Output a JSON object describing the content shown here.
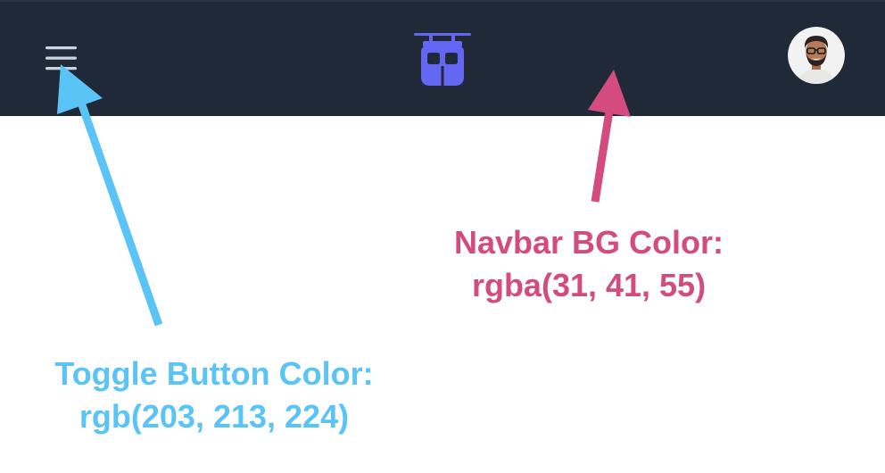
{
  "navbar": {
    "background_color": "#1f2937",
    "toggle_icon": "hamburger-menu-icon",
    "toggle_color": "#cbd5e0",
    "logo_icon": "cable-car-icon",
    "logo_color": "#6366f1",
    "avatar_icon": "user-avatar-icon"
  },
  "annotations": {
    "navbar_bg": {
      "title": "Navbar BG Color:",
      "value": "rgba(31, 41, 55)",
      "color": "#d44c7f"
    },
    "toggle_button": {
      "title": "Toggle Button Color:",
      "value": "rgb(203, 213, 224)",
      "color": "#5ac4f6"
    }
  }
}
